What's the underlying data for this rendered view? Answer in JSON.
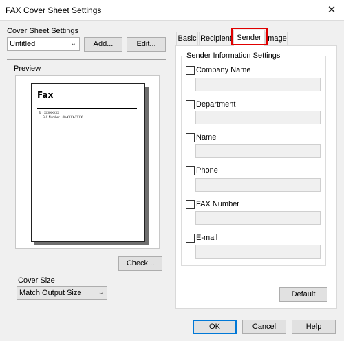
{
  "window": {
    "title": "FAX Cover Sheet Settings",
    "close_glyph": "✕"
  },
  "cover_sheet": {
    "label": "Cover Sheet Settings",
    "selected": "Untitled",
    "add_button": "Add...",
    "edit_button": "Edit..."
  },
  "preview": {
    "label": "Preview",
    "page_title": "Fax",
    "line_a": "To : XXXXXXXX",
    "line_b": "FAX Number : 00-XXXX-XXXX",
    "check_button": "Check..."
  },
  "cover_size": {
    "label": "Cover Size",
    "selected": "Match Output Size"
  },
  "tabs": [
    {
      "label": "Basic"
    },
    {
      "label": "Recipient"
    },
    {
      "label": "Sender"
    },
    {
      "label": "Image"
    }
  ],
  "sender": {
    "group_label": "Sender Information Settings",
    "items": [
      {
        "label": "Company Name",
        "value": ""
      },
      {
        "label": "Department",
        "value": ""
      },
      {
        "label": "Name",
        "value": ""
      },
      {
        "label": "Phone",
        "value": ""
      },
      {
        "label": "FAX Number",
        "value": ""
      },
      {
        "label": "E-mail",
        "value": ""
      }
    ],
    "default_button": "Default"
  },
  "footer": {
    "ok": "OK",
    "cancel": "Cancel",
    "help": "Help"
  },
  "colors": {
    "highlight": "#e00000",
    "focus": "#0078d7"
  }
}
